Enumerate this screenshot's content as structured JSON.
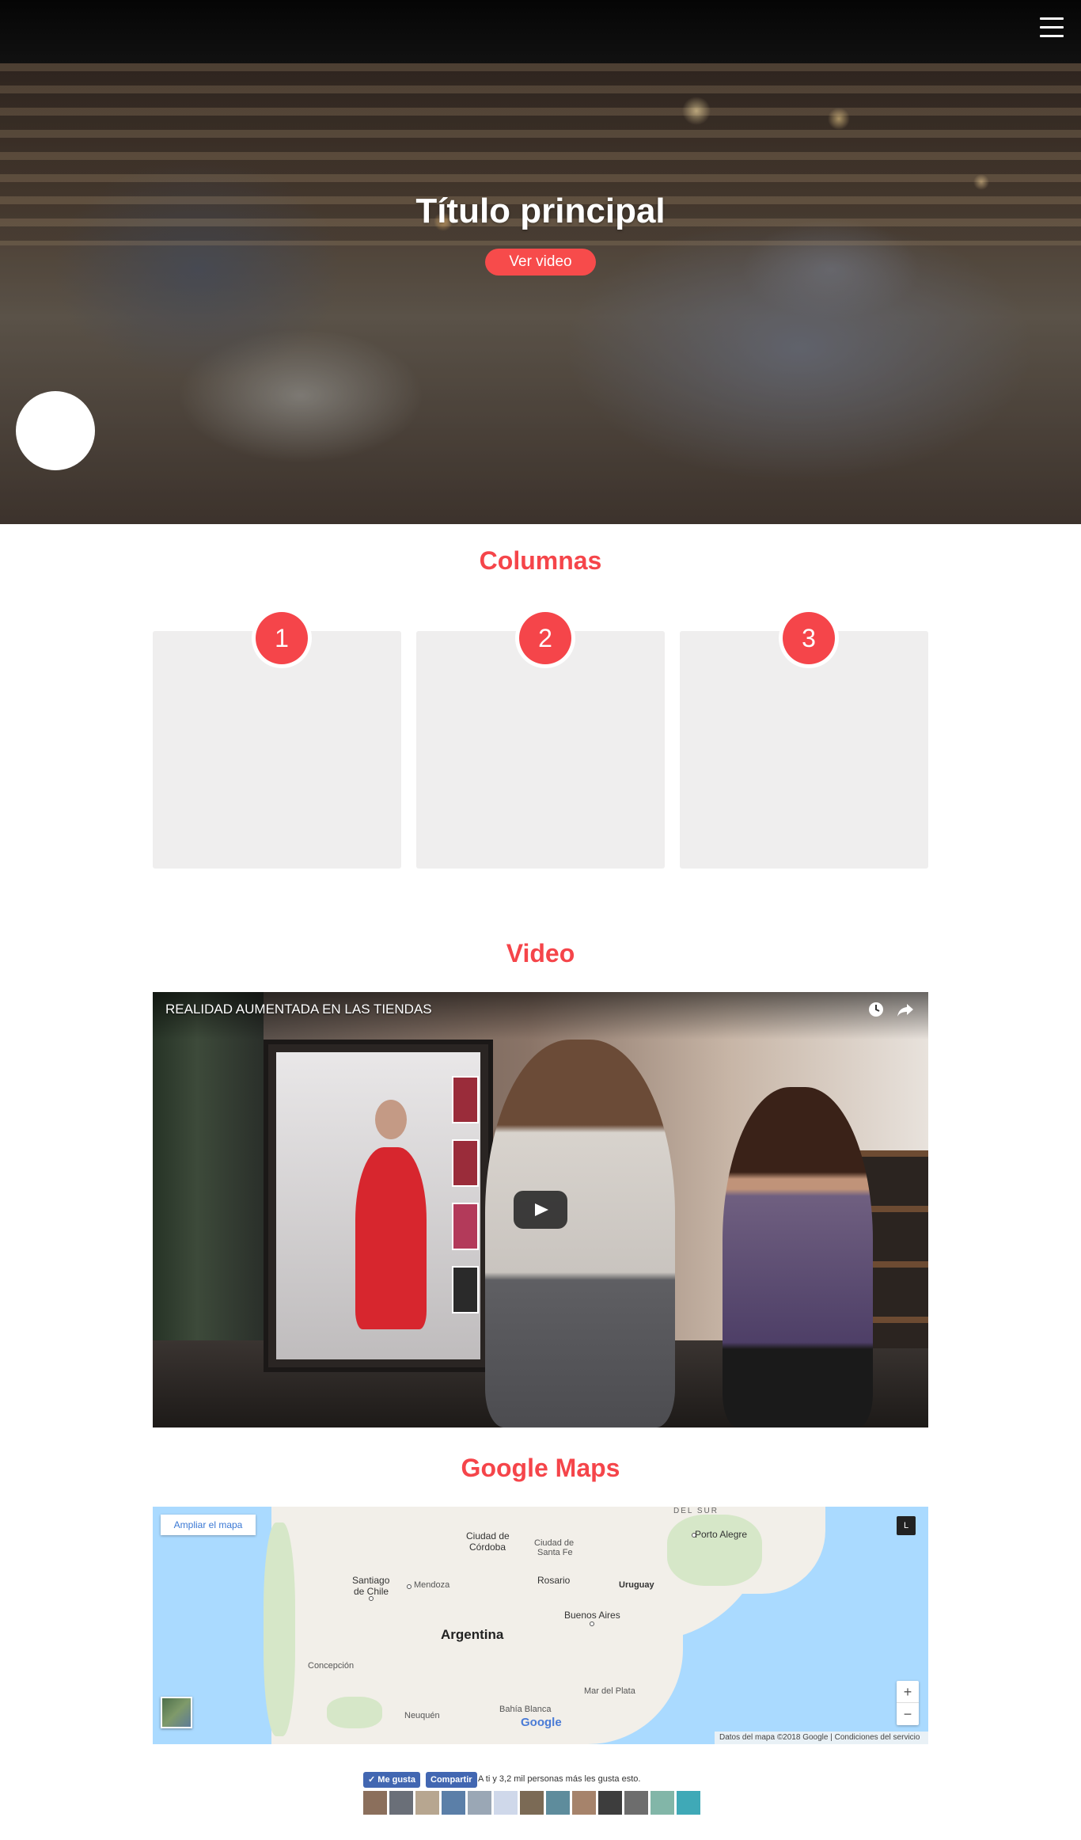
{
  "header": {
    "menu_icon": "hamburger-menu-icon"
  },
  "hero": {
    "title": "Título principal",
    "button_label": "Ver video",
    "accent_color": "#f74b4b"
  },
  "columns": {
    "heading": "Columnas",
    "items": [
      {
        "number": "1"
      },
      {
        "number": "2"
      },
      {
        "number": "3"
      }
    ]
  },
  "video": {
    "heading": "Video",
    "title": "REALIDAD AUMENTADA EN LAS TIENDAS",
    "icons": [
      "clock-icon",
      "share-icon",
      "play-icon"
    ]
  },
  "map": {
    "heading": "Google Maps",
    "enlarge_label": "Ampliar el mapa",
    "fullscreen_label": "L",
    "zoom_in": "+",
    "zoom_out": "−",
    "labels": {
      "del_sur": "DEL SUR",
      "porto_alegre": "Porto Alegre",
      "ciudad_cordoba_1": "Ciudad de",
      "ciudad_cordoba_2": "Córdoba",
      "ciudad_santa_fe_1": "Ciudad de",
      "ciudad_santa_fe_2": "Santa Fe",
      "santiago_1": "Santiago",
      "santiago_2": "de Chile",
      "mendoza": "Mendoza",
      "rosario": "Rosario",
      "uruguay": "Uruguay",
      "buenos_aires": "Buenos Aires",
      "argentina": "Argentina",
      "concepcion": "Concepción",
      "mar_del_plata": "Mar del Plata",
      "bahia_blanca": "Bahía Blanca",
      "neuquen": "Neuquén"
    },
    "google": "Google",
    "footer": "Datos del mapa ©2018 Google  |  Condiciones del servicio"
  },
  "facebook": {
    "like_label": "Me gusta",
    "share_label": "Compartir",
    "social_text": "A ti y 3,2 mil personas más les gusta esto.",
    "brand_color": "#4267b2"
  }
}
